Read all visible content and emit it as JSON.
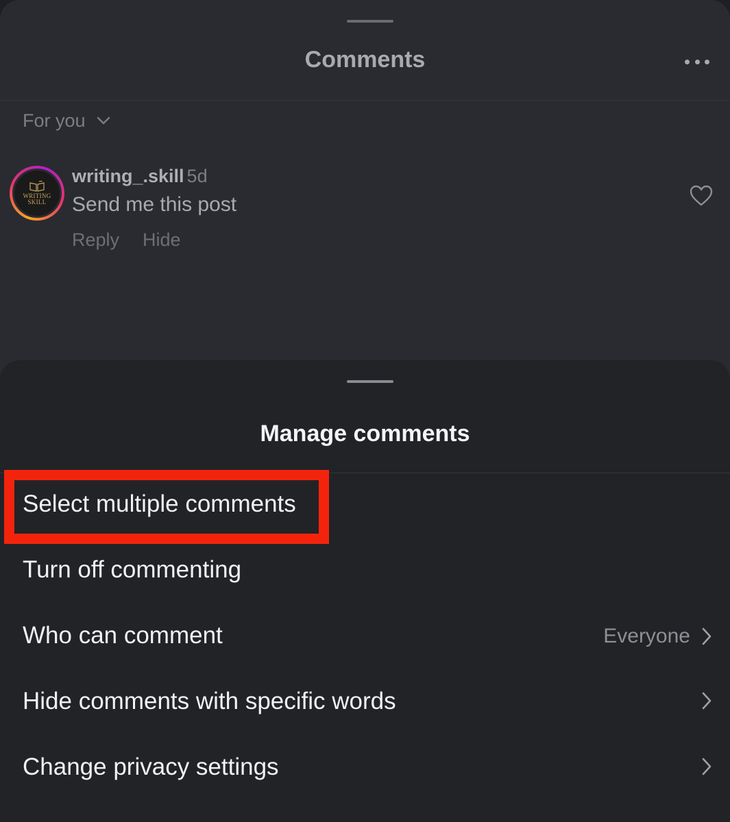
{
  "background_sheet": {
    "title": "Comments",
    "filter_label": "For you",
    "comment": {
      "username": "writing_.skill",
      "time": "5d",
      "text": "Send me this post",
      "reply_label": "Reply",
      "hide_label": "Hide",
      "avatar_text_line1": "WRITING",
      "avatar_text_line2": "SKILL"
    }
  },
  "manage_sheet": {
    "title": "Manage comments",
    "items": [
      {
        "label": "Select multiple comments",
        "highlighted": true
      },
      {
        "label": "Turn off commenting"
      },
      {
        "label": "Who can comment",
        "value": "Everyone"
      },
      {
        "label": "Hide comments with specific words"
      },
      {
        "label": "Change privacy settings"
      }
    ]
  },
  "colors": {
    "highlight": "#f4240c",
    "sheet_background": "#222327",
    "dimmed_background": "#2a2b30"
  },
  "icons": [
    "more-icon",
    "chevron-down-icon",
    "heart-icon",
    "chevron-right-icon"
  ]
}
